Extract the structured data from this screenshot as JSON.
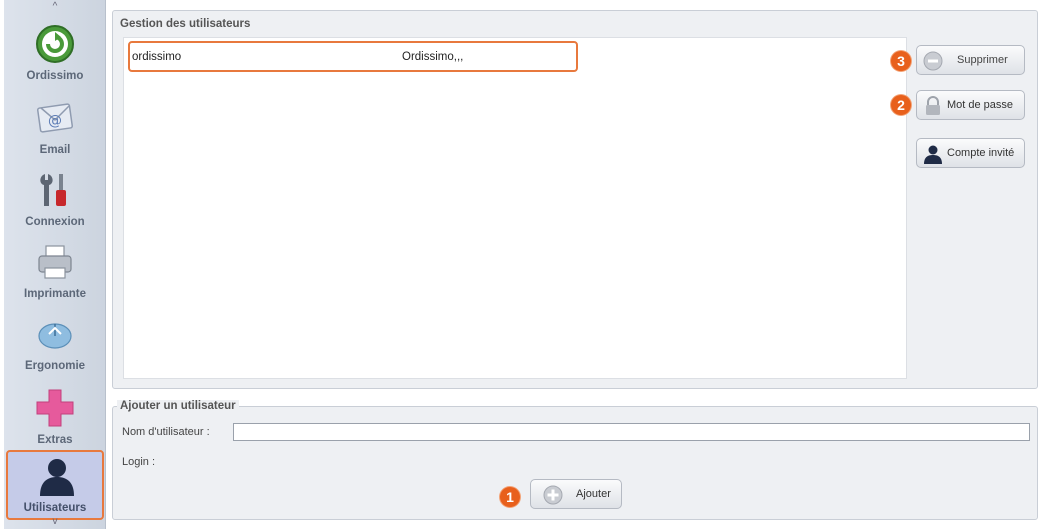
{
  "sidebar": {
    "items": [
      {
        "label": "Ordissimo",
        "icon": "ordissimo-logo-icon"
      },
      {
        "label": "Email",
        "icon": "envelope-icon"
      },
      {
        "label": "Connexion",
        "icon": "wrench-screwdriver-icon"
      },
      {
        "label": "Imprimante",
        "icon": "printer-icon"
      },
      {
        "label": "Ergonomie",
        "icon": "mouse-icon"
      },
      {
        "label": "Extras",
        "icon": "plus-icon"
      },
      {
        "label": "Utilisateurs",
        "icon": "user-icon",
        "active": true
      }
    ],
    "scroll_up": "^",
    "scroll_down": "v"
  },
  "users_panel": {
    "title": "Gestion des utilisateurs",
    "rows": [
      {
        "login": "ordissimo",
        "fullname": "Ordissimo,,,"
      }
    ],
    "buttons": {
      "delete_label": "Supprimer",
      "password_label": "Mot de passe",
      "guest_label": "Compte invité"
    }
  },
  "add_panel": {
    "title": "Ajouter un utilisateur",
    "username_label": "Nom d'utilisateur :",
    "username_value": "",
    "login_label": "Login :",
    "add_label": "Ajouter"
  },
  "badges": {
    "step1": "1",
    "step2": "2",
    "step3": "3"
  },
  "colors": {
    "accent": "#e8793d",
    "badge": "#e8601c",
    "active_bg": "#c5cbe8"
  }
}
